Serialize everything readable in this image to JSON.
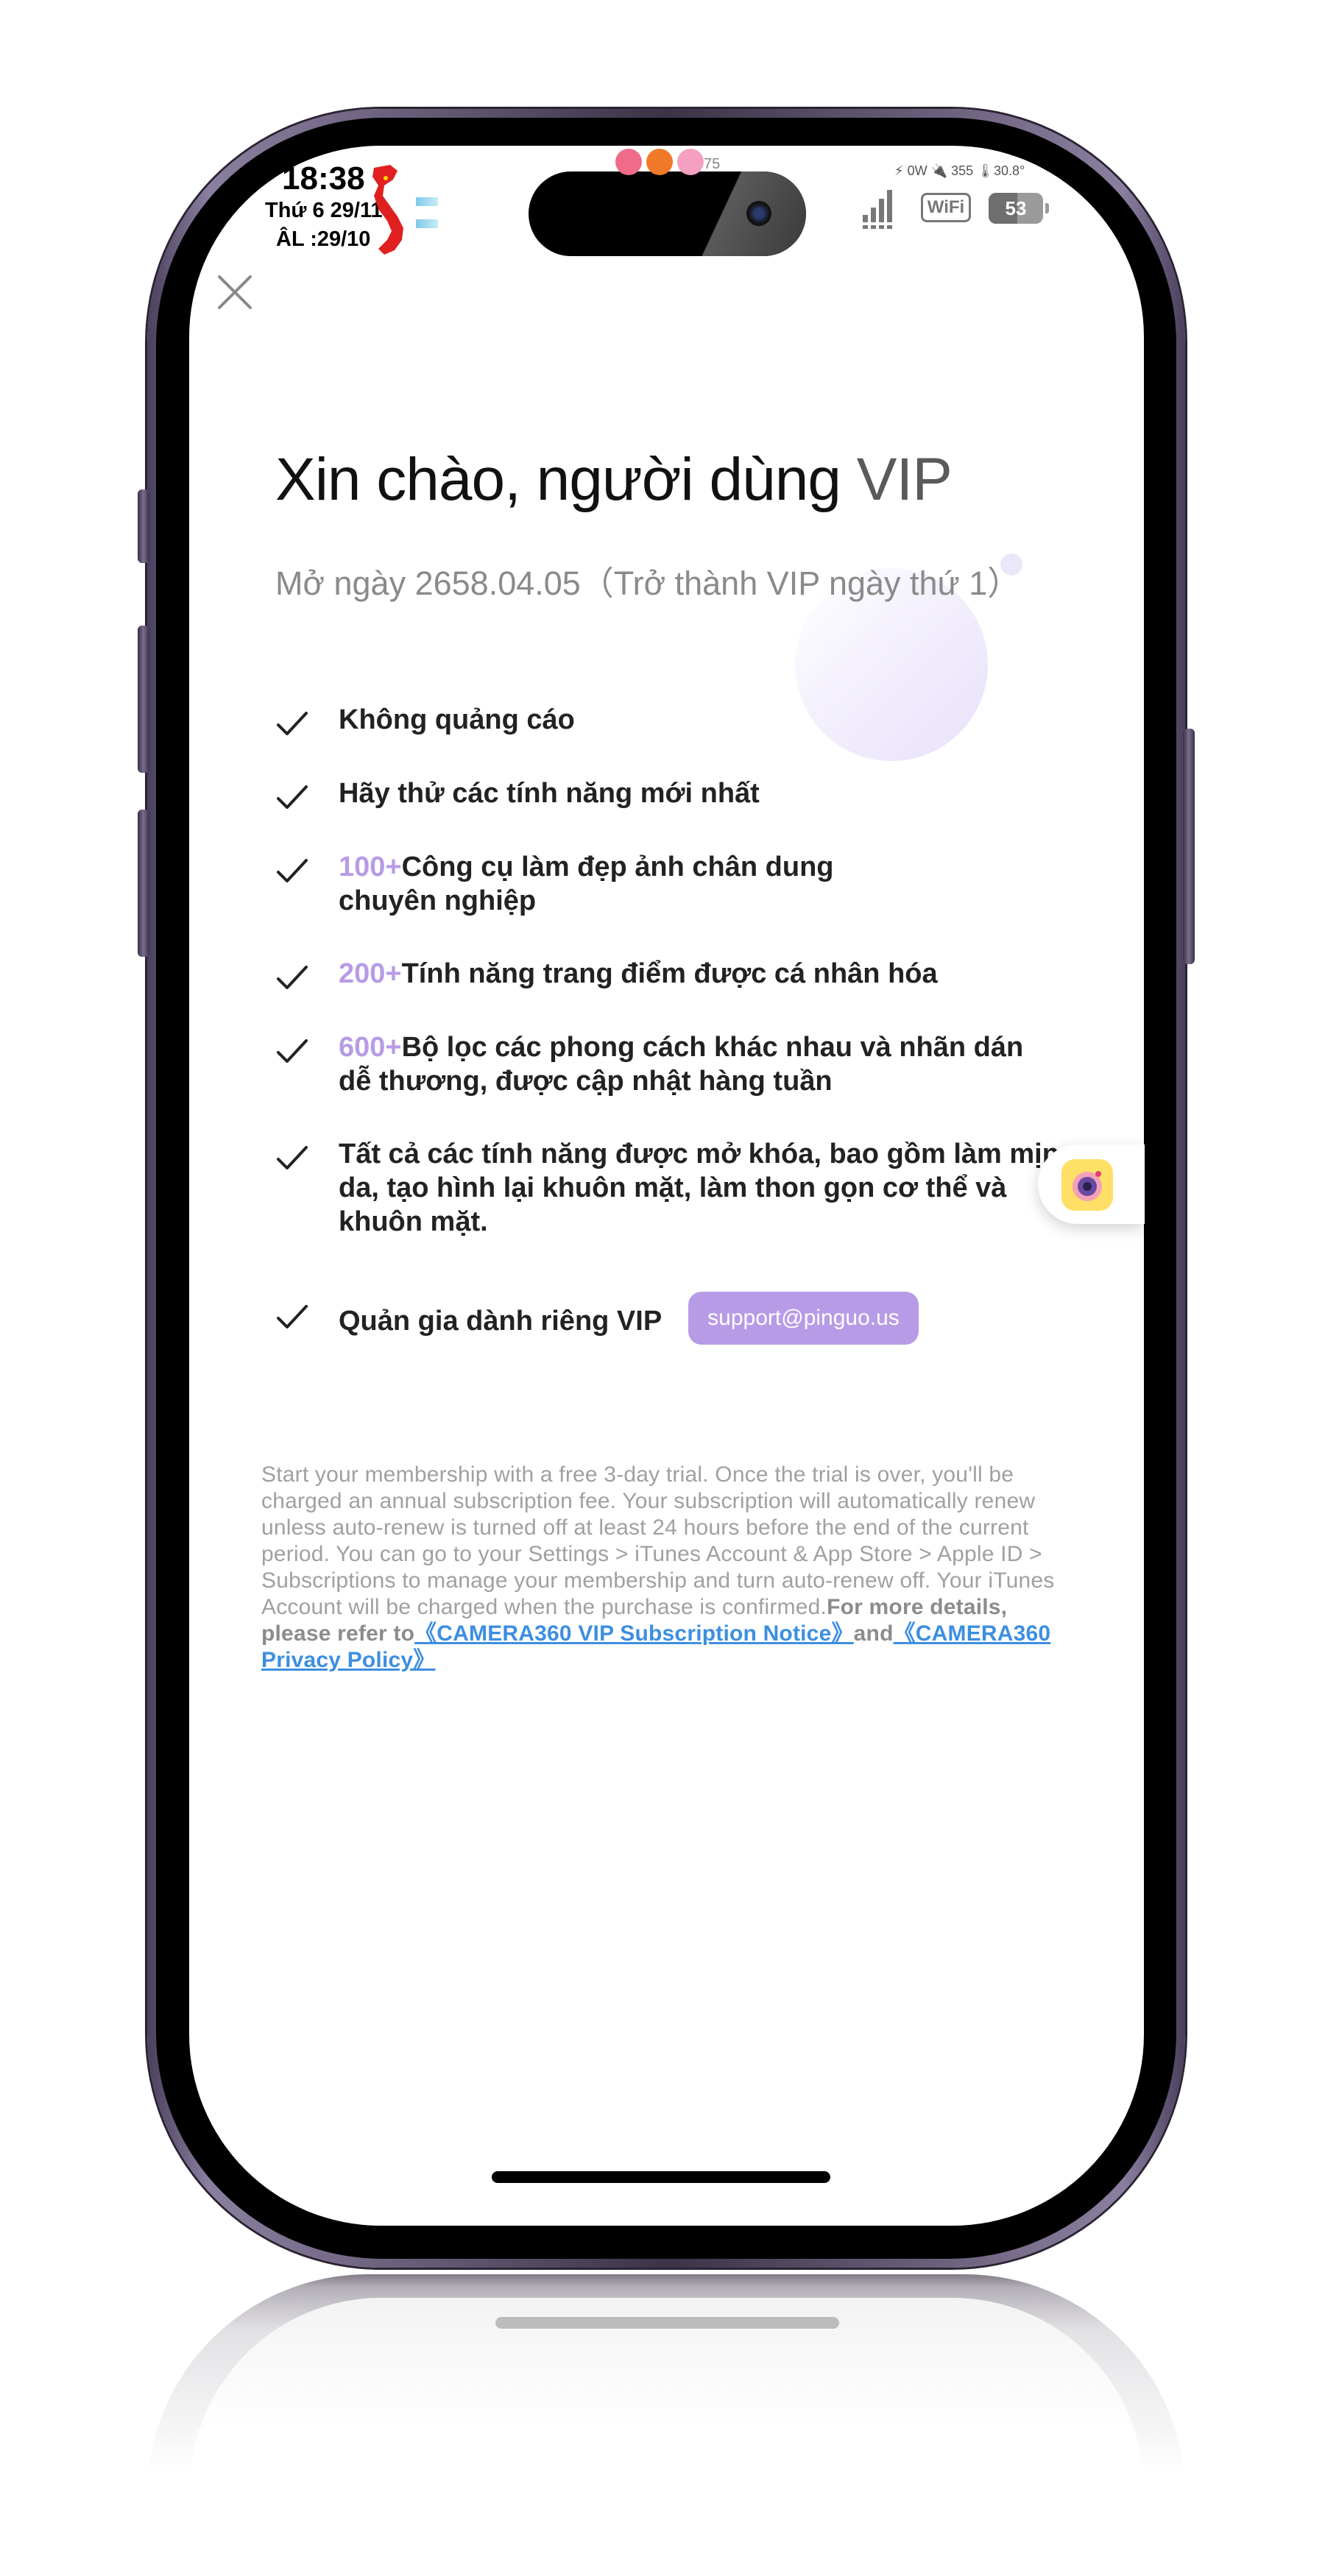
{
  "status_bar": {
    "time": "18:38",
    "date": "Thứ 6 29/11",
    "lunar_date": "ÂL :29/10",
    "center_count": "75",
    "stats": "⚡ 0W 🔌 355 🌡30.8°",
    "wifi_label": "WiFi",
    "battery": "53"
  },
  "header": {
    "close_icon": "close-icon"
  },
  "hero": {
    "title_main": "Xin chào, người dùng ",
    "title_vip": "VIP",
    "subtitle": "Mở ngày 2658.04.05（Trở thành VIP ngày thứ 1）"
  },
  "features": [
    {
      "accent": "",
      "text": "Không quảng cáo"
    },
    {
      "accent": "",
      "text": "Hãy thử các tính năng mới nhất"
    },
    {
      "accent": "100+",
      "text": "Công cụ làm đẹp ảnh chân dung chuyên nghiệp"
    },
    {
      "accent": "200+",
      "text": "Tính năng trang điểm được cá nhân hóa"
    },
    {
      "accent": "600+",
      "text": "Bộ lọc các phong cách khác nhau và nhãn dán dễ thương, được cập nhật hàng tuần"
    },
    {
      "accent": "",
      "text": "Tất cả các tính năng được mở khóa, bao gồm làm mịn da, tạo hình lại khuôn mặt, làm thon gọn cơ thể và khuôn mặt."
    },
    {
      "accent": "",
      "text": "Quản gia dành riêng VIP"
    }
  ],
  "support_email": "support@pinguo.us",
  "legal": {
    "body": "Start your membership with a free 3-day trial. Once the trial is over, you'll be charged an annual subscription fee. Your subscription will automatically renew unless auto-renew is turned off at least 24 hours before the end of the current period. You can go to your Settings > iTunes Account & App Store > Apple ID > Subscriptions to manage your membership and turn auto-renew off. Your iTunes Account will be charged when the purchase is confirmed.",
    "more": "For more details, please refer to",
    "link1": "《CAMERA360 VIP Subscription Notice》",
    "and": "and",
    "link2": "《CAMERA360 Privacy Policy》"
  },
  "colors": {
    "accent": "#b89be6",
    "link": "#3d8fe0"
  }
}
